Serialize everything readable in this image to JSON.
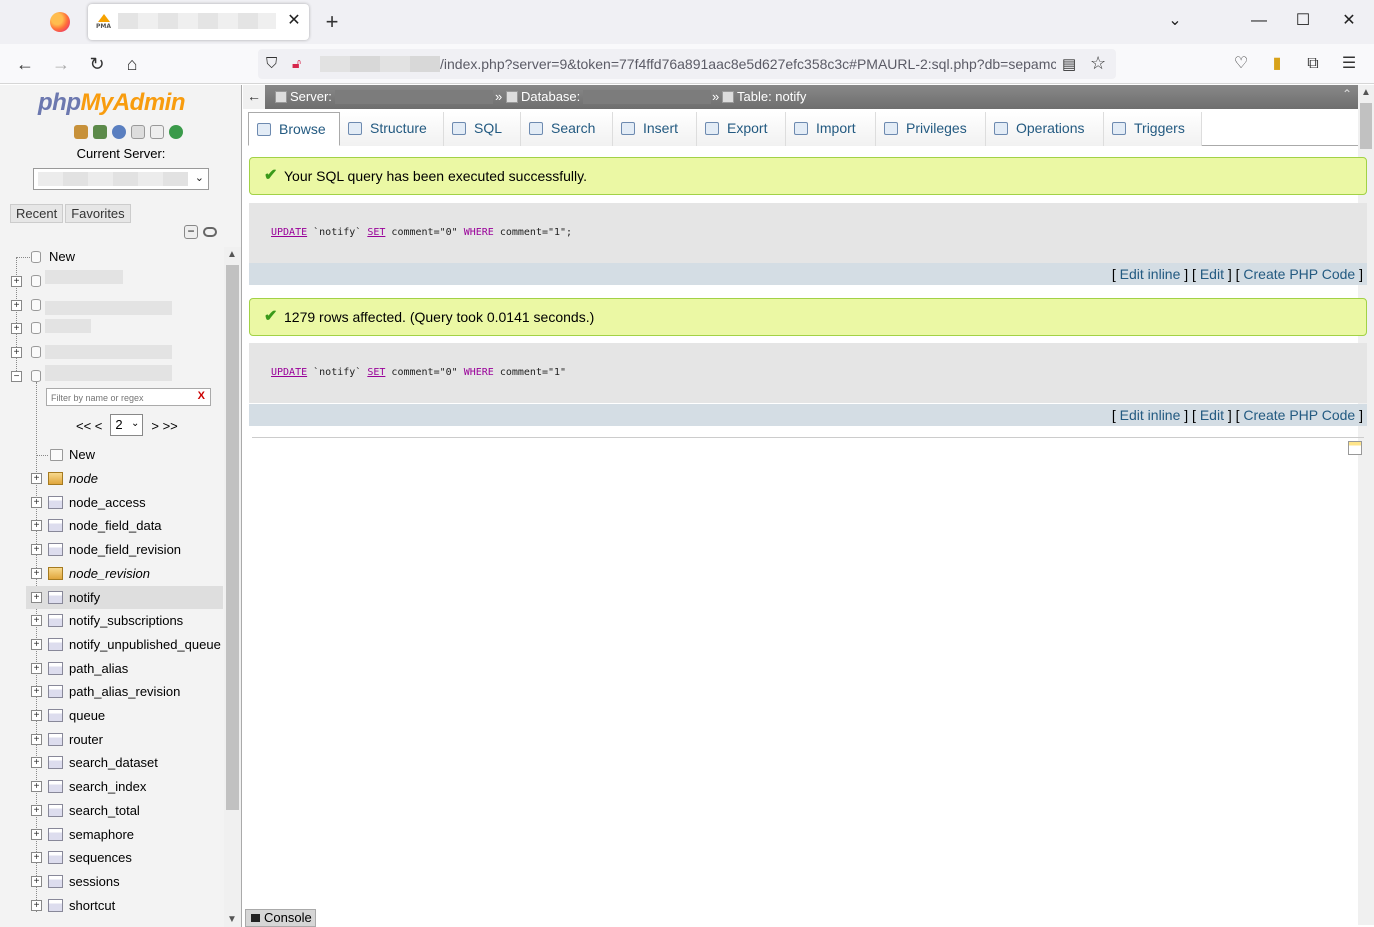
{
  "browser": {
    "url_visible": "/index.php?server=9&token=77f4ffd76a891aac8e5d627efc358c3c#PMAURL-2:sql.php?db=sepamco",
    "tab_favicon_text": "PMA",
    "tab_close": "✕",
    "new_tab": "+",
    "window_controls": {
      "list": "⌄",
      "minimize": "—",
      "maximize": "☐",
      "close": "✕"
    },
    "nav": {
      "back": "←",
      "forward": "→",
      "reload": "↻",
      "home": "⌂"
    }
  },
  "sidebar": {
    "logo_php": "php",
    "logo_myadmin": "MyAdmin",
    "current_server_label": "Current Server:",
    "tab_recent": "Recent",
    "tab_favorites": "Favorites",
    "collapse": "−",
    "top_new": "New",
    "filter_placeholder": "Filter by name or regex",
    "filter_clear": "X",
    "pager_first_prev": "<< <",
    "page_value": "2",
    "pager_next_last": "> >>",
    "db_new": "New",
    "tables": [
      {
        "name": "node",
        "italic": true,
        "view": true
      },
      {
        "name": "node_access"
      },
      {
        "name": "node_field_data"
      },
      {
        "name": "node_field_revision"
      },
      {
        "name": "node_revision",
        "italic": true,
        "view": true
      },
      {
        "name": "notify",
        "selected": true
      },
      {
        "name": "notify_subscriptions"
      },
      {
        "name": "notify_unpublished_queue"
      },
      {
        "name": "path_alias"
      },
      {
        "name": "path_alias_revision"
      },
      {
        "name": "queue"
      },
      {
        "name": "router"
      },
      {
        "name": "search_dataset"
      },
      {
        "name": "search_index"
      },
      {
        "name": "search_total"
      },
      {
        "name": "semaphore"
      },
      {
        "name": "sequences"
      },
      {
        "name": "sessions"
      },
      {
        "name": "shortcut"
      }
    ]
  },
  "breadcrumb": {
    "back": "←",
    "server_label": "Server:",
    "database_label": "Database:",
    "table_label": "Table: notify",
    "sep": "»"
  },
  "tabs": [
    "Browse",
    "Structure",
    "SQL",
    "Search",
    "Insert",
    "Export",
    "Import",
    "Privileges",
    "Operations",
    "Triggers"
  ],
  "messages": {
    "success_1": "Your SQL query has been executed successfully.",
    "success_2": "1279 rows affected. (Query took 0.0141 seconds.)"
  },
  "queries": {
    "q1_rest1": " `notify` ",
    "q1_rest2": " comment=\"0\" ",
    "q1_rest3": " comment=\"1\";",
    "q2_rest3": " comment=\"1\"",
    "kw_update": "UPDATE",
    "kw_set": "SET",
    "kw_where": "WHERE"
  },
  "query_links": {
    "open": "[ ",
    "edit_inline": "Edit inline",
    "mid": " ] [ ",
    "edit": "Edit",
    "create_php": "Create PHP Code",
    "close": " ]"
  },
  "console_label": "Console"
}
